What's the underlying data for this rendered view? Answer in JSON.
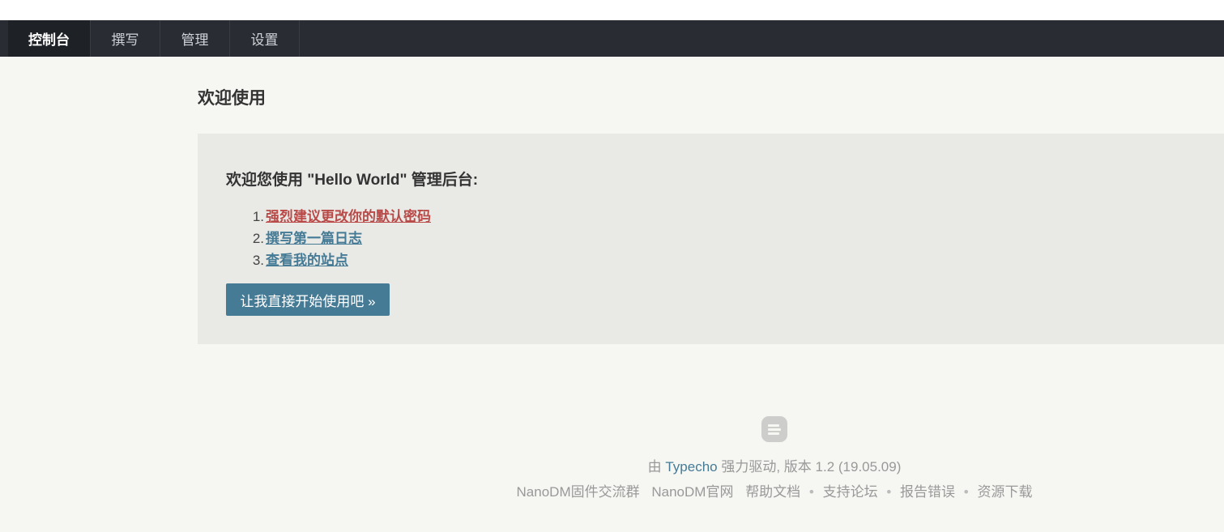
{
  "nav": {
    "items": [
      {
        "label": "控制台",
        "active": true
      },
      {
        "label": "撰写",
        "active": false
      },
      {
        "label": "管理",
        "active": false
      },
      {
        "label": "设置",
        "active": false
      }
    ]
  },
  "page": {
    "title": "欢迎使用"
  },
  "welcome": {
    "heading": "欢迎您使用 \"Hello World\" 管理后台:",
    "items": [
      {
        "num": "1.",
        "label": "强烈建议更改你的默认密码"
      },
      {
        "num": "2.",
        "label": "撰写第一篇日志"
      },
      {
        "num": "3.",
        "label": "查看我的站点"
      }
    ],
    "start_button": "让我直接开始使用吧 »"
  },
  "footer": {
    "powered_prefix": "由",
    "powered_link": "Typecho",
    "powered_suffix": "强力驱动, 版本 1.2 (19.05.09)",
    "links": [
      "NanoDM固件交流群",
      "NanoDM官网",
      "帮助文档",
      "支持论坛",
      "报告错误",
      "资源下载"
    ],
    "separator": "•"
  },
  "colors": {
    "navbar": "#292d33",
    "accent": "#467b96",
    "warning": "#b94a48",
    "background": "#f6f6f3"
  }
}
